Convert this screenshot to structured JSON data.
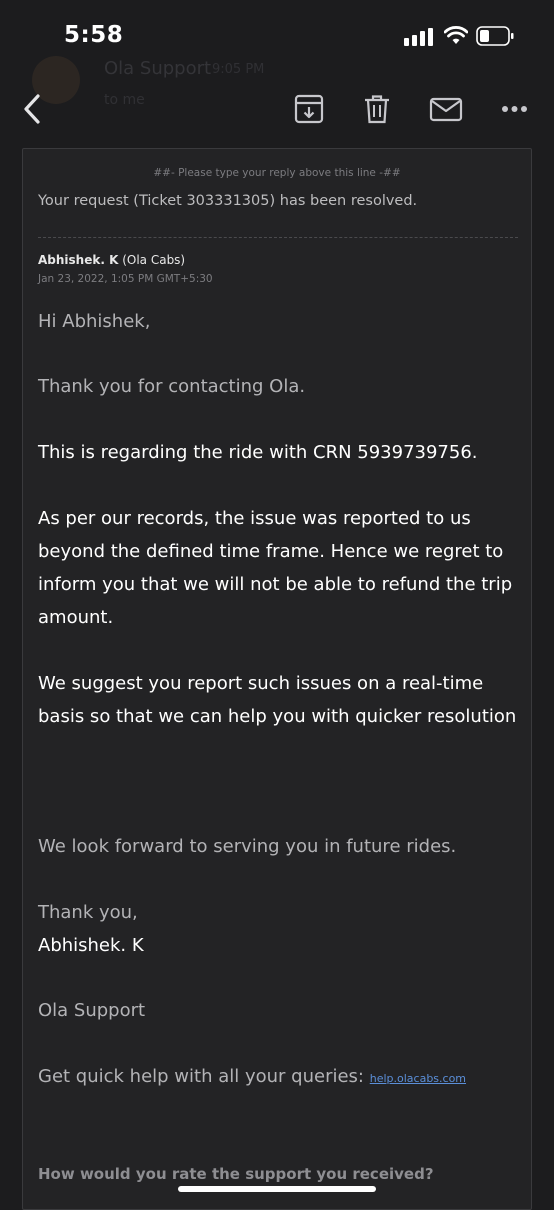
{
  "status": {
    "time": "5:58"
  },
  "header_ghost": {
    "sender": "Ola Support",
    "time": "9:05 PM",
    "to": "to me"
  },
  "toolbar": {
    "back_icon": "chevron-left-icon",
    "archive_icon": "archive-icon",
    "trash_icon": "trash-icon",
    "mail_icon": "mail-icon",
    "more_icon": "more-horizontal-icon"
  },
  "email": {
    "reply_line": "##- Please type your reply above this line -##",
    "ticket_text": "Your request (Ticket 303331305) has been resolved.",
    "author_name": "Abhishek. K",
    "author_org": "(Ola Cabs)",
    "date": "Jan 23, 2022, 1:05 PM GMT+5:30",
    "greeting": "Hi Abhishek,",
    "thanks_contact": "Thank you for contacting Ola.",
    "regarding": "This is regarding the ride with CRN 5939739756.",
    "records": "As per our records, the issue was reported to us beyond the defined time frame. Hence we regret to inform you that we will not be able to refund the trip amount.",
    "suggest": "We suggest you report such issues on a real-time basis so that we can help you with quicker resolution",
    "forward": "We look forward to serving you in future rides.",
    "thank_you": "Thank you,",
    "signature": "Abhishek. K",
    "team": "Ola Support",
    "help_text": "Get quick help with all your queries:",
    "help_link": "help.olacabs.com",
    "rate_question": "How would you rate the support you received?"
  },
  "colors": {
    "background": "#1c1c1e",
    "card": "#232325",
    "link": "#5b8fd9"
  }
}
